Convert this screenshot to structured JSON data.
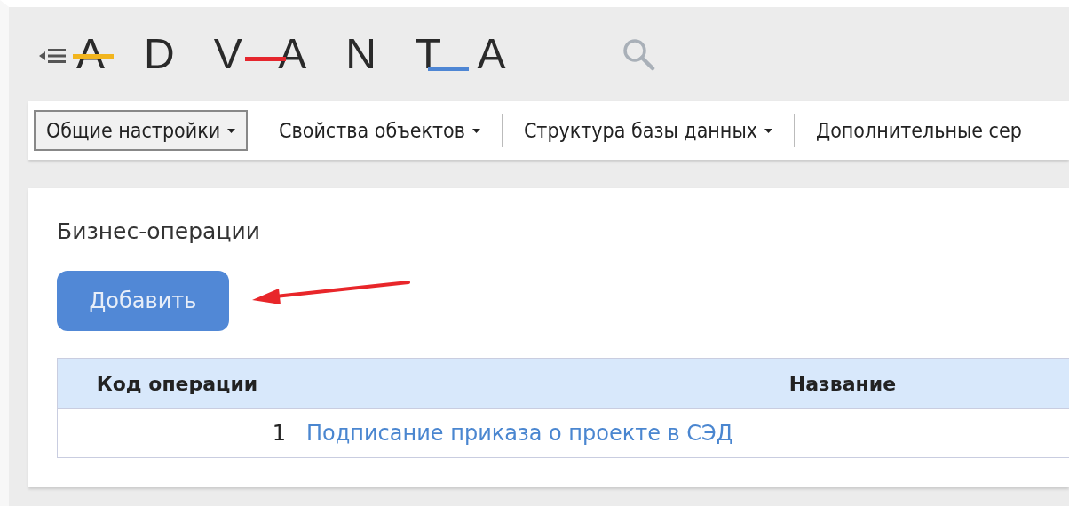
{
  "logo": {
    "text": "ADVANTA"
  },
  "menu": [
    {
      "label": "Общие настройки",
      "caret": true,
      "selected": true
    },
    {
      "label": "Свойства объектов",
      "caret": true,
      "selected": false
    },
    {
      "label": "Структура базы данных",
      "caret": true,
      "selected": false
    },
    {
      "label": "Дополнительные сер",
      "caret": false,
      "selected": false
    }
  ],
  "panel": {
    "title": "Бизнес-операции",
    "add_button": "Добавить",
    "table": {
      "columns": [
        "Код операции",
        "Название"
      ],
      "rows": [
        {
          "code": "1",
          "name": "Подписание приказа о проекте в СЭД"
        }
      ]
    }
  }
}
